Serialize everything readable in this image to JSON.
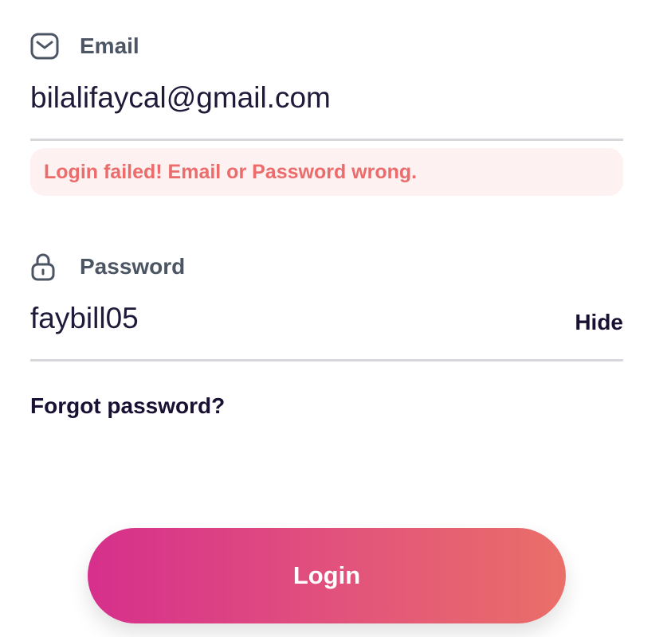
{
  "email": {
    "label": "Email",
    "icon": "envelope-icon",
    "value": "bilalifaycal@gmail.com"
  },
  "error": {
    "message": "Login failed! Email or Password wrong.",
    "text_color": "#ec6b6b",
    "background_color": "#fdf1f1"
  },
  "password": {
    "label": "Password",
    "icon": "lock-icon",
    "value": "faybill05",
    "toggle_label": "Hide"
  },
  "forgot_password_label": "Forgot password?",
  "login": {
    "label": "Login",
    "gradient_start": "#d62f8c",
    "gradient_end": "#ea6f68"
  }
}
